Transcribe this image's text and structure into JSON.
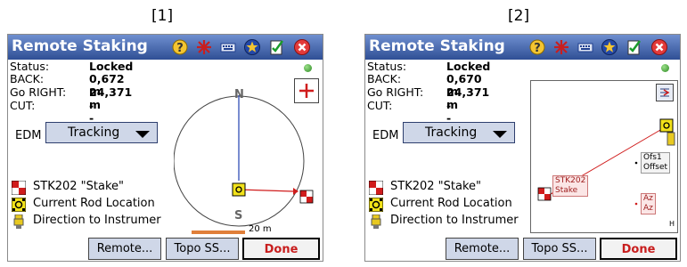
{
  "captions": [
    "[1]",
    "[2]"
  ],
  "panels": [
    {
      "title": "Remote Staking",
      "toolbar_icons": [
        "help-icon",
        "star-burst-icon",
        "keyboard-icon",
        "favorite-star-icon",
        "checklist-icon",
        "close-icon"
      ],
      "status": {
        "label": "Status:",
        "value": "Locked"
      },
      "back": {
        "label": "BACK:",
        "value": "0,672 m"
      },
      "go_right": {
        "label": "Go RIGHT:",
        "value": "24,371 m"
      },
      "cut": {
        "label": "CUT:",
        "value": "---"
      },
      "edm": {
        "label": "EDM",
        "value": "Tracking"
      },
      "legend": [
        "STK202 \"Stake\"",
        "Current Rod Location",
        "Direction to Instrumer"
      ],
      "compass": {
        "north": "N",
        "south": "S"
      },
      "scale_label": "20 m",
      "buttons": {
        "remote": "Remote...",
        "topo": "Topo SS...",
        "done": "Done"
      },
      "status_color": "#3aa52b",
      "accent_red": "#d01c1c"
    },
    {
      "title": "Remote Staking",
      "toolbar_icons": [
        "help-icon",
        "star-burst-icon",
        "keyboard-icon",
        "favorite-star-icon",
        "checklist-icon",
        "close-icon"
      ],
      "status": {
        "label": "Status:",
        "value": "Locked"
      },
      "back": {
        "label": "BACK:",
        "value": "0,670 m"
      },
      "go_right": {
        "label": "Go RIGHT:",
        "value": "24,371 m"
      },
      "cut": {
        "label": "CUT:",
        "value": "---"
      },
      "edm": {
        "label": "EDM",
        "value": "Tracking"
      },
      "legend": [
        "STK202 \"Stake\"",
        "Current Rod Location",
        "Direction to Instrumer"
      ],
      "map_labels": {
        "stake_name": "STK202",
        "stake_desc": "Stake",
        "ofs1": "Ofs1",
        "offset": "Offset",
        "az1": "Az",
        "az2": "Az",
        "corner": "H"
      },
      "buttons": {
        "remote": "Remote...",
        "topo": "Topo SS...",
        "done": "Done"
      }
    }
  ]
}
